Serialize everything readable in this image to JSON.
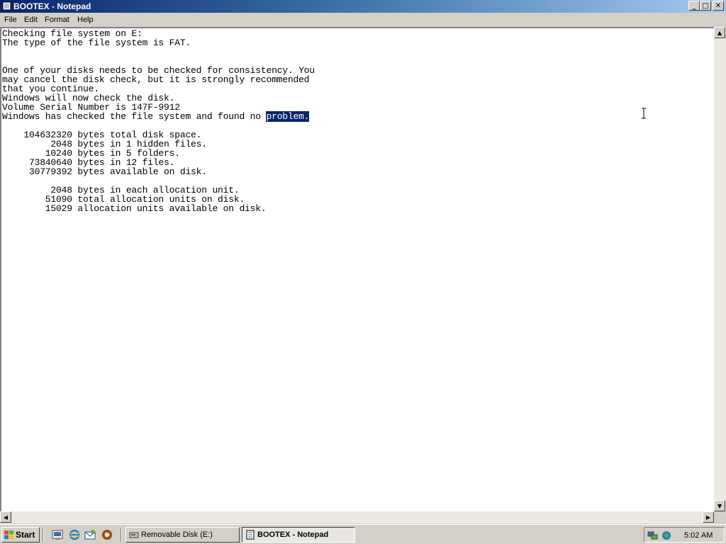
{
  "window": {
    "title": "BOOTEX - Notepad",
    "buttons": {
      "minimize": "_",
      "maximize": "□",
      "close": "✕"
    }
  },
  "menu": {
    "items": [
      {
        "label": "File"
      },
      {
        "label": "Edit"
      },
      {
        "label": "Format"
      },
      {
        "label": "Help"
      }
    ]
  },
  "document": {
    "lines": [
      "Checking file system on E:",
      "The type of the file system is FAT.",
      "",
      "",
      "One of your disks needs to be checked for consistency. You",
      "may cancel the disk check, but it is strongly recommended",
      "that you continue.",
      "Windows will now check the disk.",
      "Volume Serial Number is 147F-9912",
      "Windows has checked the file system and found no ",
      "",
      "    104632320 bytes total disk space.",
      "         2048 bytes in 1 hidden files.",
      "        10240 bytes in 5 folders.",
      "     73840640 bytes in 12 files.",
      "     30779392 bytes available on disk.",
      "",
      "         2048 bytes in each allocation unit.",
      "        51090 total allocation units on disk.",
      "        15029 allocation units available on disk."
    ],
    "selected_text": "problem."
  },
  "scrollbars": {
    "up": "▲",
    "down": "▼",
    "left": "◀",
    "right": "▶"
  },
  "taskbar": {
    "start_label": "Start",
    "tasks": [
      {
        "label": "Removable Disk (E:)",
        "active": false
      },
      {
        "label": "BOOTEX - Notepad",
        "active": true
      }
    ],
    "clock": "5:02 AM"
  },
  "colors": {
    "title_active": "#0a246a",
    "selection": "#0a246a",
    "face": "#d4d0c8"
  },
  "icons": {
    "title": "notepad-icon",
    "quick_launch": [
      "show-desktop-icon",
      "internet-explorer-icon",
      "outlook-express-icon",
      "media-player-icon"
    ],
    "tray": [
      "network-icon",
      "volume-icon"
    ]
  }
}
